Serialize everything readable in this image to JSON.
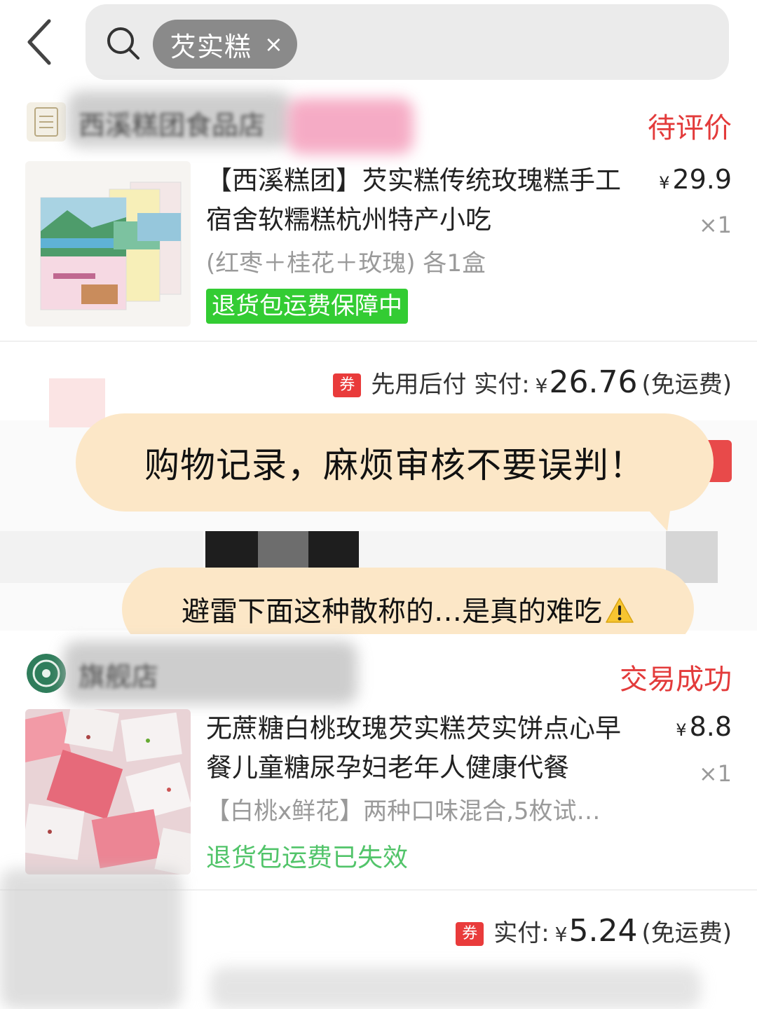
{
  "header": {
    "search_chip": "芡实糕",
    "chip_close": "×"
  },
  "orders": [
    {
      "shop_name": "西溪糕团食品店",
      "status": "待评价",
      "title": "【西溪糕团】芡实糕传统玫瑰糕手工宿舍软糯糕杭州特产小吃",
      "sku": "(红枣＋桂花＋玫瑰) 各1盒",
      "price": "29.9",
      "qty": "×1",
      "insurance": "退货包运费保障中",
      "coupon": "券",
      "pay_label": "先用后付  实付:",
      "yen": "¥",
      "pay_amount": "26.76",
      "pay_ship": "(免运费)"
    },
    {
      "shop_name": "旗舰店",
      "status": "交易成功",
      "title": "无蔗糖白桃玫瑰芡实糕芡实饼点心早餐儿童糖尿孕妇老年人健康代餐",
      "sku": "【白桃x鲜花】两种口味混合,5枚试…",
      "price": "8.8",
      "qty": "×1",
      "insurance": "退货包运费已失效",
      "coupon": "券",
      "pay_label": "实付:",
      "yen": "¥",
      "pay_amount": "5.24",
      "pay_ship": "(免运费)"
    }
  ],
  "bubbles": {
    "top": "购物记录，麻烦审核不要误判！",
    "bottom": "避雷下面这种散称的…是真的难吃"
  },
  "icons": {
    "back": "chevron-left-icon",
    "search": "search-icon",
    "warning": "warning-icon"
  },
  "colors": {
    "status_red": "#e33b3b",
    "insurance_green": "#33cc33",
    "bubble_bg": "#fce7c7",
    "search_bg": "#ebebeb"
  }
}
